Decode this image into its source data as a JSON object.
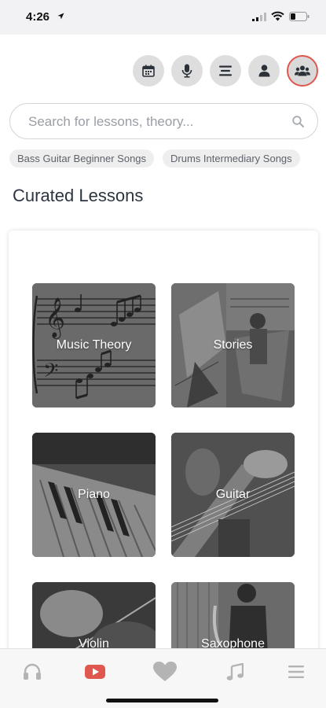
{
  "status_bar": {
    "time": "4:26"
  },
  "header": {
    "buttons": [
      "calendar-icon",
      "microphone-icon",
      "list-icon",
      "user-icon",
      "group-icon"
    ],
    "active_color": "#e0574f"
  },
  "search": {
    "placeholder": "Search for lessons, theory..."
  },
  "chips": [
    "Bass Guitar Beginner Songs",
    "Drums Intermediary Songs"
  ],
  "section": {
    "title": "Curated Lessons"
  },
  "lessons": [
    {
      "label": "Music Theory"
    },
    {
      "label": "Stories"
    },
    {
      "label": "Piano"
    },
    {
      "label": "Guitar"
    },
    {
      "label": "Violin"
    },
    {
      "label": "Saxophone"
    }
  ],
  "tabbar": {
    "items": [
      "headphones-icon",
      "youtube-icon",
      "heart-icon",
      "music-note-icon",
      "menu-icon"
    ],
    "active_index": 1,
    "accent": "#e0574f"
  }
}
